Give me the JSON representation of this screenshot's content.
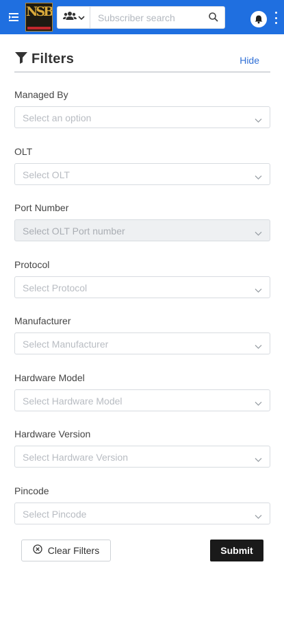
{
  "header": {
    "logo_text": "NSB",
    "search": {
      "placeholder": "Subscriber search"
    }
  },
  "filters": {
    "title": "Filters",
    "hide_label": "Hide",
    "fields": [
      {
        "label": "Managed By",
        "placeholder": "Select an option",
        "disabled": false
      },
      {
        "label": "OLT",
        "placeholder": "Select OLT",
        "disabled": false
      },
      {
        "label": "Port Number",
        "placeholder": "Select OLT Port number",
        "disabled": true
      },
      {
        "label": "Protocol",
        "placeholder": "Select Protocol",
        "disabled": false
      },
      {
        "label": "Manufacturer",
        "placeholder": "Select Manufacturer",
        "disabled": false
      },
      {
        "label": "Hardware Model",
        "placeholder": "Select Hardware Model",
        "disabled": false
      },
      {
        "label": "Hardware Version",
        "placeholder": "Select Hardware Version",
        "disabled": false
      },
      {
        "label": "Pincode",
        "placeholder": "Select Pincode",
        "disabled": false
      }
    ],
    "clear_label": "Clear Filters",
    "submit_label": "Submit"
  },
  "colors": {
    "topbar": "#1f6fe0",
    "link": "#2f6fd6",
    "submit_bg": "#1a1a1a"
  }
}
